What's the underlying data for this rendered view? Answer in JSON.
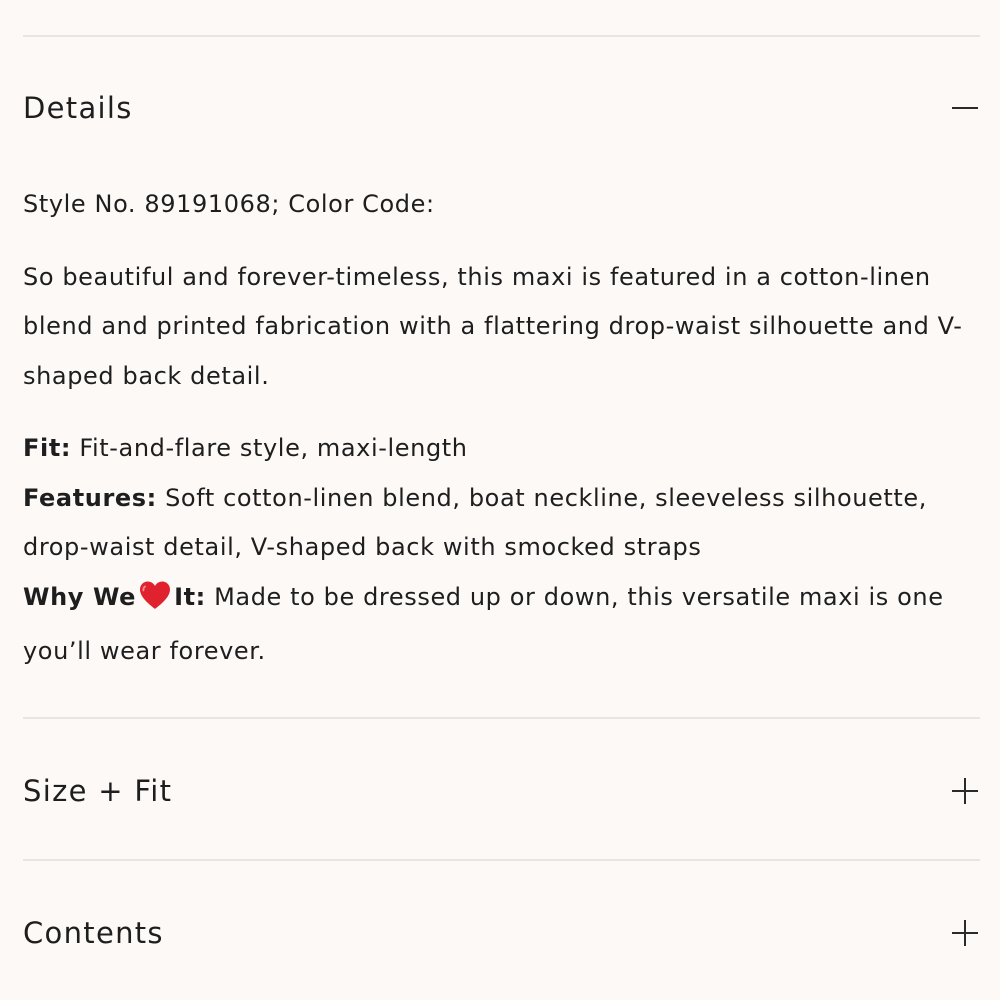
{
  "accordion": {
    "details": {
      "title": "Details",
      "expanded": true,
      "style_line": "Style No. 89191068; Color Code:",
      "description": "So beautiful and forever-timeless, this maxi is featured in a cotton-linen blend and printed fabrication with a flattering drop-waist silhouette and V-shaped back detail.",
      "fit_label": "Fit:",
      "fit_text": " Fit-and-flare style, maxi-length",
      "features_label": "Features:",
      "features_text": " Soft cotton-linen blend, boat neckline, sleeveless silhouette, drop-waist detail, V-shaped back with smocked straps",
      "why_label_pre": "Why We",
      "why_label_post": "It:",
      "why_text": " Made to be dressed up or down, this versatile maxi is one you’ll wear forever."
    },
    "size_fit": {
      "title": "Size + Fit",
      "expanded": false
    },
    "contents": {
      "title": "Contents",
      "expanded": false
    }
  },
  "icons": {
    "collapse": "minus-icon",
    "expand": "plus-icon",
    "heart": "heart-icon"
  },
  "colors": {
    "background": "#fdf9f7",
    "text": "#1e1e1e",
    "divider": "#e8e6e4",
    "heart": "#e0212e"
  }
}
